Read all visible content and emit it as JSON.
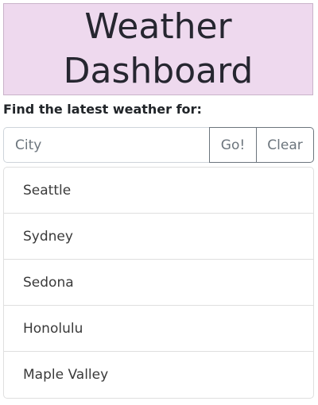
{
  "header": {
    "title": "Weather Dashboard",
    "background_color": "#eed9ee"
  },
  "search": {
    "prompt": "Find the latest weather for:",
    "placeholder": "City",
    "value": "",
    "go_label": "Go!",
    "clear_label": "Clear"
  },
  "cities": [
    {
      "label": "Seattle"
    },
    {
      "label": "Sydney"
    },
    {
      "label": "Sedona"
    },
    {
      "label": "Honolulu"
    },
    {
      "label": "Maple Valley"
    }
  ]
}
